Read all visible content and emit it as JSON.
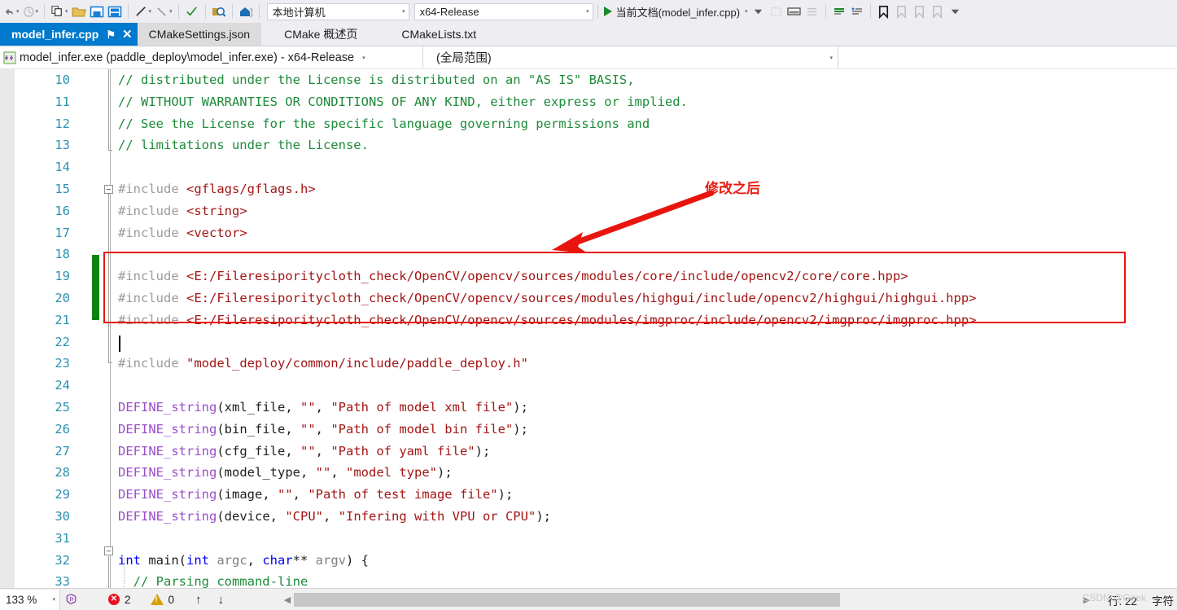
{
  "toolbar": {
    "icons": [
      {
        "name": "undo-icon",
        "glyph": "↶"
      },
      {
        "name": "redo-icon",
        "glyph": "↷"
      },
      {
        "name": "new-window-icon",
        "glyph": "❐"
      },
      {
        "name": "open-folder-icon",
        "glyph": "὜0"
      },
      {
        "name": "save-icon",
        "glyph": "὚b"
      },
      {
        "name": "save-all-icon",
        "glyph": "὚c"
      },
      {
        "name": "step-into-icon",
        "glyph": "↗"
      },
      {
        "name": "step-over-icon",
        "glyph": "↖"
      },
      {
        "name": "build-check-icon",
        "glyph": "✓"
      },
      {
        "name": "search-icon",
        "glyph": "ὐd"
      },
      {
        "name": "home-icon",
        "glyph": "⌂"
      }
    ],
    "platform_combo": "本地计算机",
    "config_combo": "x64-Release",
    "run_label": "当前文档(model_infer.cpp)",
    "right_icons": [
      {
        "name": "comment-selection-icon",
        "glyph": "≡"
      },
      {
        "name": "uncomment-selection-icon",
        "glyph": "≡"
      },
      {
        "name": "toggle-bookmark-icon",
        "glyph": "ὑ6"
      },
      {
        "name": "prev-bookmark-icon",
        "glyph": "ὑ6"
      },
      {
        "name": "next-bookmark-icon",
        "glyph": "ὑ6"
      },
      {
        "name": "clear-bookmarks-icon",
        "glyph": "ὑ6"
      },
      {
        "name": "overflow-chevron-icon",
        "glyph": "▼"
      }
    ]
  },
  "tabs": [
    {
      "label": "model_infer.cpp",
      "state": "active",
      "pin": "⚑",
      "close": "✕"
    },
    {
      "label": "CMakeSettings.json",
      "state": "inactive"
    },
    {
      "label": "CMake 概述页",
      "state": "plain"
    },
    {
      "label": "CMakeLists.txt",
      "state": "plain"
    }
  ],
  "navbar": {
    "project": "model_infer.exe (paddle_deploy\\model_infer.exe) - x64-Release",
    "scope": "(全局范围)",
    "member": "",
    "project_icon": "cpp-project-icon"
  },
  "annotation": {
    "text": "修改之后",
    "color": "#ec1c12"
  },
  "editor": {
    "first_line": 10,
    "lines": [
      {
        "no": 10,
        "segs": [
          {
            "t": "// distributed under the License is distributed on an \"AS IS\" BASIS,",
            "c": "c-comment"
          }
        ]
      },
      {
        "no": 11,
        "segs": [
          {
            "t": "// WITHOUT WARRANTIES OR CONDITIONS OF ANY KIND, either express or implied.",
            "c": "c-comment"
          }
        ]
      },
      {
        "no": 12,
        "segs": [
          {
            "t": "// See the License for the specific language governing permissions and",
            "c": "c-comment"
          }
        ]
      },
      {
        "no": 13,
        "segs": [
          {
            "t": "// limitations under the License.",
            "c": "c-comment"
          }
        ]
      },
      {
        "no": 14,
        "segs": []
      },
      {
        "no": 15,
        "segs": [
          {
            "t": "#include ",
            "c": "c-pp"
          },
          {
            "t": "<gflags/gflags.h>",
            "c": "c-str"
          }
        ]
      },
      {
        "no": 16,
        "segs": [
          {
            "t": "#include ",
            "c": "c-pp"
          },
          {
            "t": "<string>",
            "c": "c-str"
          }
        ]
      },
      {
        "no": 17,
        "segs": [
          {
            "t": "#include ",
            "c": "c-pp"
          },
          {
            "t": "<vector>",
            "c": "c-str"
          }
        ]
      },
      {
        "no": 18,
        "segs": []
      },
      {
        "no": 19,
        "segs": [
          {
            "t": "#include ",
            "c": "c-pp"
          },
          {
            "t": "<E:/Fileresiporitycloth_check/OpenCV/opencv/sources/modules/core/include/opencv2/core/core.hpp>",
            "c": "c-str"
          }
        ]
      },
      {
        "no": 20,
        "segs": [
          {
            "t": "#include ",
            "c": "c-pp"
          },
          {
            "t": "<E:/Fileresiporitycloth_check/OpenCV/opencv/sources/modules/highgui/include/opencv2/highgui/highgui.hpp>",
            "c": "c-str"
          }
        ]
      },
      {
        "no": 21,
        "segs": [
          {
            "t": "#include ",
            "c": "c-pp"
          },
          {
            "t": "<E:/Fileresiporitycloth_check/OpenCV/opencv/sources/modules/imgproc/include/opencv2/imgproc/imgproc.hpp>",
            "c": "c-str"
          }
        ]
      },
      {
        "no": 22,
        "segs": []
      },
      {
        "no": 23,
        "segs": [
          {
            "t": "#include ",
            "c": "c-pp"
          },
          {
            "t": "\"model_deploy/common/include/paddle_deploy.h\"",
            "c": "c-str"
          }
        ]
      },
      {
        "no": 24,
        "segs": []
      },
      {
        "no": 25,
        "segs": [
          {
            "t": "DEFINE_string",
            "c": "c-macro"
          },
          {
            "t": "(xml_file, ",
            "c": "c-plain"
          },
          {
            "t": "\"\"",
            "c": "c-str"
          },
          {
            "t": ", ",
            "c": "c-plain"
          },
          {
            "t": "\"Path of model xml file\"",
            "c": "c-str"
          },
          {
            "t": ");",
            "c": "c-plain"
          }
        ]
      },
      {
        "no": 26,
        "segs": [
          {
            "t": "DEFINE_string",
            "c": "c-macro"
          },
          {
            "t": "(bin_file, ",
            "c": "c-plain"
          },
          {
            "t": "\"\"",
            "c": "c-str"
          },
          {
            "t": ", ",
            "c": "c-plain"
          },
          {
            "t": "\"Path of model bin file\"",
            "c": "c-str"
          },
          {
            "t": ");",
            "c": "c-plain"
          }
        ]
      },
      {
        "no": 27,
        "segs": [
          {
            "t": "DEFINE_string",
            "c": "c-macro"
          },
          {
            "t": "(cfg_file, ",
            "c": "c-plain"
          },
          {
            "t": "\"\"",
            "c": "c-str"
          },
          {
            "t": ", ",
            "c": "c-plain"
          },
          {
            "t": "\"Path of yaml file\"",
            "c": "c-str"
          },
          {
            "t": ");",
            "c": "c-plain"
          }
        ]
      },
      {
        "no": 28,
        "segs": [
          {
            "t": "DEFINE_string",
            "c": "c-macro"
          },
          {
            "t": "(model_type, ",
            "c": "c-plain"
          },
          {
            "t": "\"\"",
            "c": "c-str"
          },
          {
            "t": ", ",
            "c": "c-plain"
          },
          {
            "t": "\"model type\"",
            "c": "c-str"
          },
          {
            "t": ");",
            "c": "c-plain"
          }
        ]
      },
      {
        "no": 29,
        "segs": [
          {
            "t": "DEFINE_string",
            "c": "c-macro"
          },
          {
            "t": "(image, ",
            "c": "c-plain"
          },
          {
            "t": "\"\"",
            "c": "c-str"
          },
          {
            "t": ", ",
            "c": "c-plain"
          },
          {
            "t": "\"Path of test image file\"",
            "c": "c-str"
          },
          {
            "t": ");",
            "c": "c-plain"
          }
        ]
      },
      {
        "no": 30,
        "segs": [
          {
            "t": "DEFINE_string",
            "c": "c-macro"
          },
          {
            "t": "(device, ",
            "c": "c-plain"
          },
          {
            "t": "\"CPU\"",
            "c": "c-str"
          },
          {
            "t": ", ",
            "c": "c-plain"
          },
          {
            "t": "\"Infering with VPU or CPU\"",
            "c": "c-str"
          },
          {
            "t": ");",
            "c": "c-plain"
          }
        ]
      },
      {
        "no": 31,
        "segs": []
      },
      {
        "no": 32,
        "segs": [
          {
            "t": "int",
            "c": "c-kw"
          },
          {
            "t": " main(",
            "c": "c-plain"
          },
          {
            "t": "int",
            "c": "c-kw"
          },
          {
            "t": " ",
            "c": "c-plain"
          },
          {
            "t": "argc",
            "c": "c-ident"
          },
          {
            "t": ", ",
            "c": "c-plain"
          },
          {
            "t": "char",
            "c": "c-kw"
          },
          {
            "t": "** ",
            "c": "c-plain"
          },
          {
            "t": "argv",
            "c": "c-ident"
          },
          {
            "t": ") {",
            "c": "c-plain"
          }
        ]
      },
      {
        "no": 33,
        "segs": [
          {
            "t": "  // Parsing command-line",
            "c": "c-comment"
          }
        ]
      }
    ]
  },
  "statusbar": {
    "zoom": "133 %",
    "zoom_arrow": "▾",
    "brain_icon": "intellisense-icon",
    "error_count": "2",
    "warning_count": "0",
    "up_arrow": "↑",
    "down_arrow": "↓",
    "scroll_left": "◀",
    "scroll_right": "▶",
    "line_label": "行: 22",
    "char_label": "字符",
    "watermark": "CSDN @Geek"
  }
}
